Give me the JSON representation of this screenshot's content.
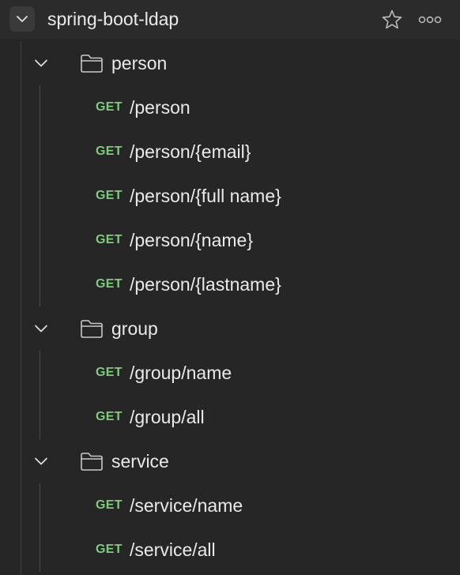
{
  "collection": {
    "title": "spring-boot-ldap",
    "collapse_icon": "chevron-down-icon",
    "star_icon": "star-icon",
    "more_icon": "more-options-icon"
  },
  "colors": {
    "background": "#262626",
    "header": "#2b2b2b",
    "method_get": "#7ccc7c",
    "text": "#eaeaea"
  },
  "folders": [
    {
      "label": "person",
      "requests": [
        {
          "method": "GET",
          "path": "/person"
        },
        {
          "method": "GET",
          "path": "/person/{email}"
        },
        {
          "method": "GET",
          "path": "/person/{full name}"
        },
        {
          "method": "GET",
          "path": "/person/{name}"
        },
        {
          "method": "GET",
          "path": "/person/{lastname}"
        }
      ]
    },
    {
      "label": "group",
      "requests": [
        {
          "method": "GET",
          "path": "/group/name"
        },
        {
          "method": "GET",
          "path": "/group/all"
        }
      ]
    },
    {
      "label": "service",
      "requests": [
        {
          "method": "GET",
          "path": "/service/name"
        },
        {
          "method": "GET",
          "path": "/service/all"
        }
      ]
    }
  ]
}
